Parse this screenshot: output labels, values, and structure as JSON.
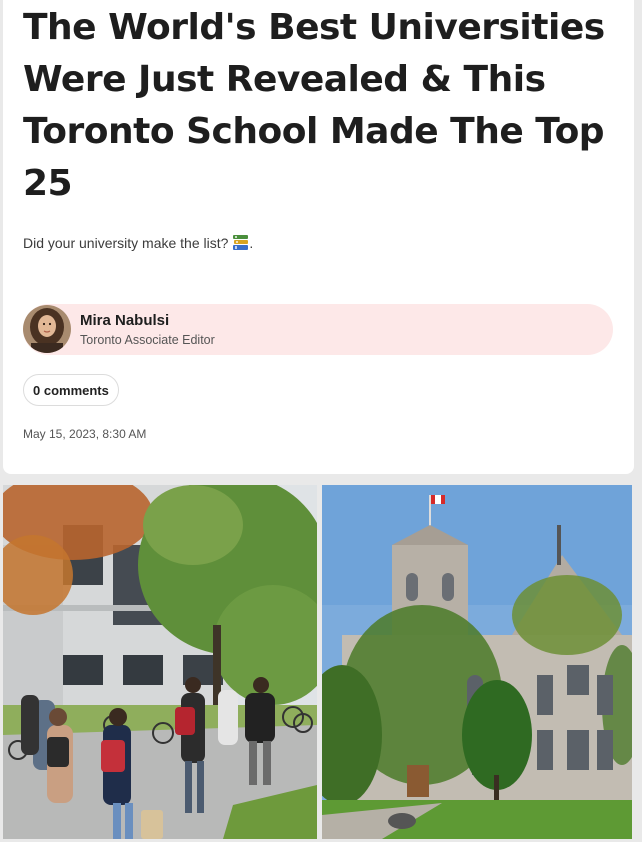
{
  "article": {
    "headline": "The World's Best Universities Were Just Revealed & This Toronto School Made The Top 25",
    "dek": "Did your university make the list?",
    "dek_icon": "books-emoji",
    "date": "May 15, 2023, 8:30 AM"
  },
  "author": {
    "name": "Mira Nabulsi",
    "role": "Toronto Associate Editor"
  },
  "comments": {
    "label": "0 comments"
  },
  "colors": {
    "author_bar_bg": "#fde8e8",
    "page_bg": "#e9e9e9"
  }
}
